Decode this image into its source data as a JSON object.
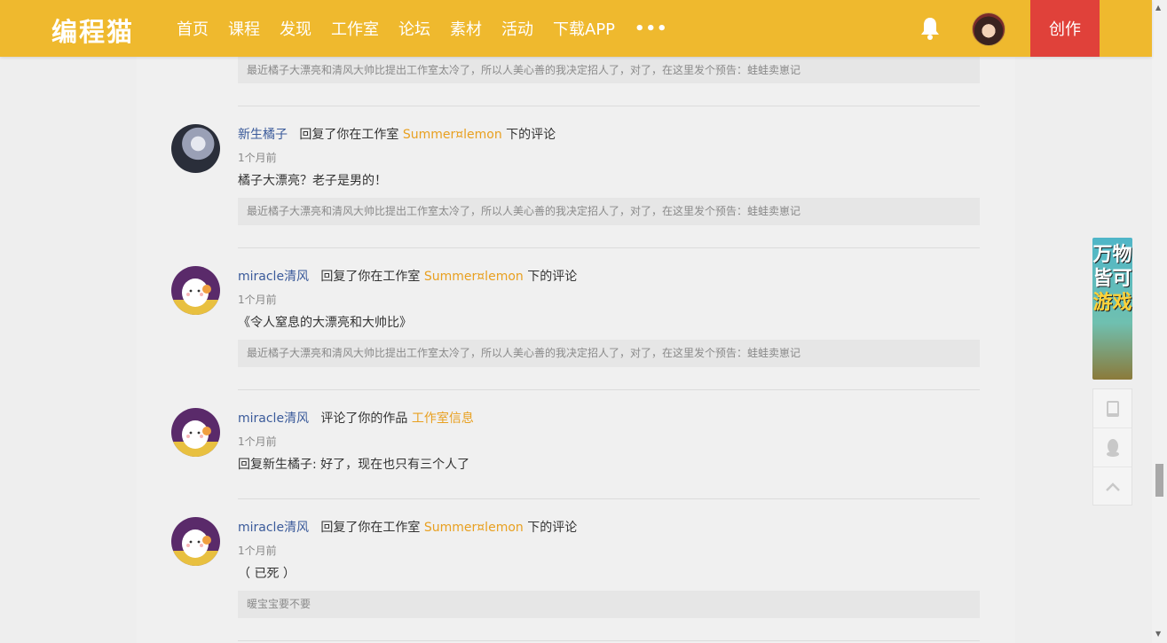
{
  "nav": {
    "logo": "编程猫",
    "items": [
      "首页",
      "课程",
      "发现",
      "工作室",
      "论坛",
      "素材",
      "活动",
      "下载APP"
    ],
    "more": "•••",
    "create": "创作"
  },
  "top_quote": "最近橘子大漂亮和清风大帅比提出工作室太冷了，所以人美心善的我决定招人了，对了，在这里发个预告：蛙蛙卖崽记",
  "notifications": [
    {
      "user": "新生橘子",
      "action": "回复了你在工作室",
      "target": "Summer¤lemon",
      "suffix": "下的评论",
      "time": "1个月前",
      "content": "橘子大漂亮？老子是男的！",
      "quote": "最近橘子大漂亮和清风大帅比提出工作室太冷了，所以人美心善的我决定招人了，对了，在这里发个预告：蛙蛙卖崽记"
    },
    {
      "user": "miracle清风",
      "action": "回复了你在工作室",
      "target": "Summer¤lemon",
      "suffix": "下的评论",
      "time": "1个月前",
      "content": "《令人窒息的大漂亮和大帅比》",
      "quote": "最近橘子大漂亮和清风大帅比提出工作室太冷了，所以人美心善的我决定招人了，对了，在这里发个预告：蛙蛙卖崽记"
    },
    {
      "user": "miracle清风",
      "action": "评论了你的作品",
      "target": "工作室信息",
      "suffix": "",
      "time": "1个月前",
      "content": "回复新生橘子:   好了，现在也只有三个人了",
      "quote": ""
    },
    {
      "user": "miracle清风",
      "action": "回复了你在工作室",
      "target": "Summer¤lemon",
      "suffix": "下的评论",
      "time": "1个月前",
      "content": "（ 已死 ）",
      "quote": "暖宝宝要不要"
    }
  ],
  "ad": {
    "line1": "万物",
    "line2": "皆可",
    "line3": "游戏"
  },
  "colors": {
    "brand": "#efb92e",
    "create": "#e0413a",
    "username": "#3a5a9a",
    "target": "#e8a020"
  }
}
